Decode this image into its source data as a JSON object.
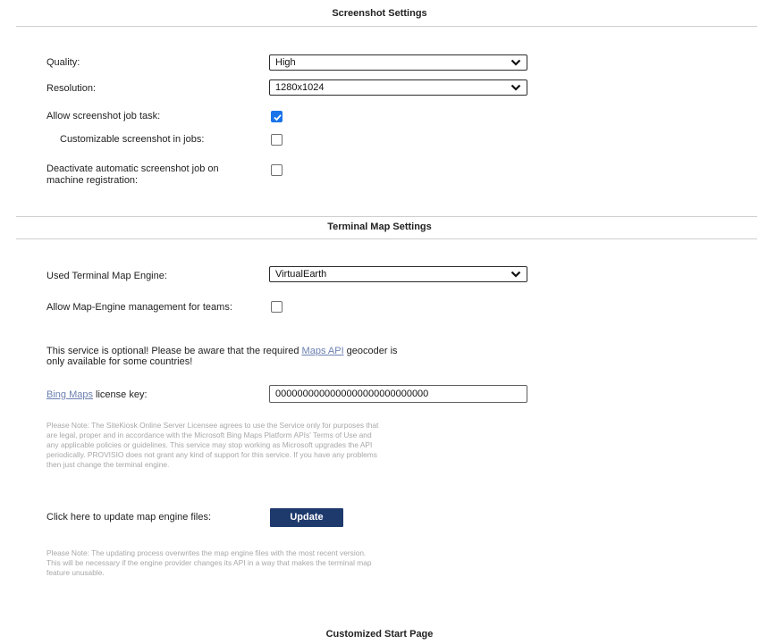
{
  "screenshot_settings": {
    "title": "Screenshot Settings",
    "quality_label": "Quality:",
    "quality_value": "High",
    "resolution_label": "Resolution:",
    "resolution_value": "1280x1024",
    "allow_job_task_label": "Allow screenshot job task:",
    "allow_job_task_checked": true,
    "customizable_label": "Customizable screenshot in jobs:",
    "customizable_checked": false,
    "deactivate_label_line1": "Deactivate automatic screenshot job on",
    "deactivate_label_line2": "machine registration:",
    "deactivate_checked": false
  },
  "terminal_map_settings": {
    "title": "Terminal Map Settings",
    "engine_label": "Used Terminal Map Engine:",
    "engine_value": "VirtualEarth",
    "allow_team_mgmt_label": "Allow Map-Engine management for teams:",
    "allow_team_mgmt_checked": false,
    "optional_text_1": "This service is optional! Please be aware that the required ",
    "optional_link": "Maps API",
    "optional_text_2": " geocoder is",
    "optional_text_line2": "only available for some countries!",
    "license_link": "Bing Maps",
    "license_label_rest": " license key:",
    "license_value": "0000000000000000000000000000",
    "note_1_lines": [
      "Please Note: The SiteKiosk Online Server Licensee agrees to use the Service only for purposes that",
      "are legal, proper and in accordance with the Microsoft Bing Maps Platform APIs' Terms of Use and",
      "any applicable policies or guidelines. This service may stop working as Microsoft upgrades the API",
      "periodically. PROVISIO does not grant any kind of support for this service. If you have any problems",
      "then just change the terminal engine."
    ],
    "update_label": "Click here to update map engine files:",
    "update_button": "Update",
    "note_2_lines": [
      "Please Note: The updating process overwrites the map engine files with the most recent version.",
      "This will be necessary if the engine provider changes its API in a way that makes the terminal map",
      "feature unusable."
    ]
  },
  "customized_start_page": {
    "title": "Customized Start Page"
  },
  "colors": {
    "checkbox_checked": "#1a73e8",
    "button_bg": "#1e3a6d",
    "link": "#6b7fb0",
    "note_text": "#a8a8a8"
  }
}
